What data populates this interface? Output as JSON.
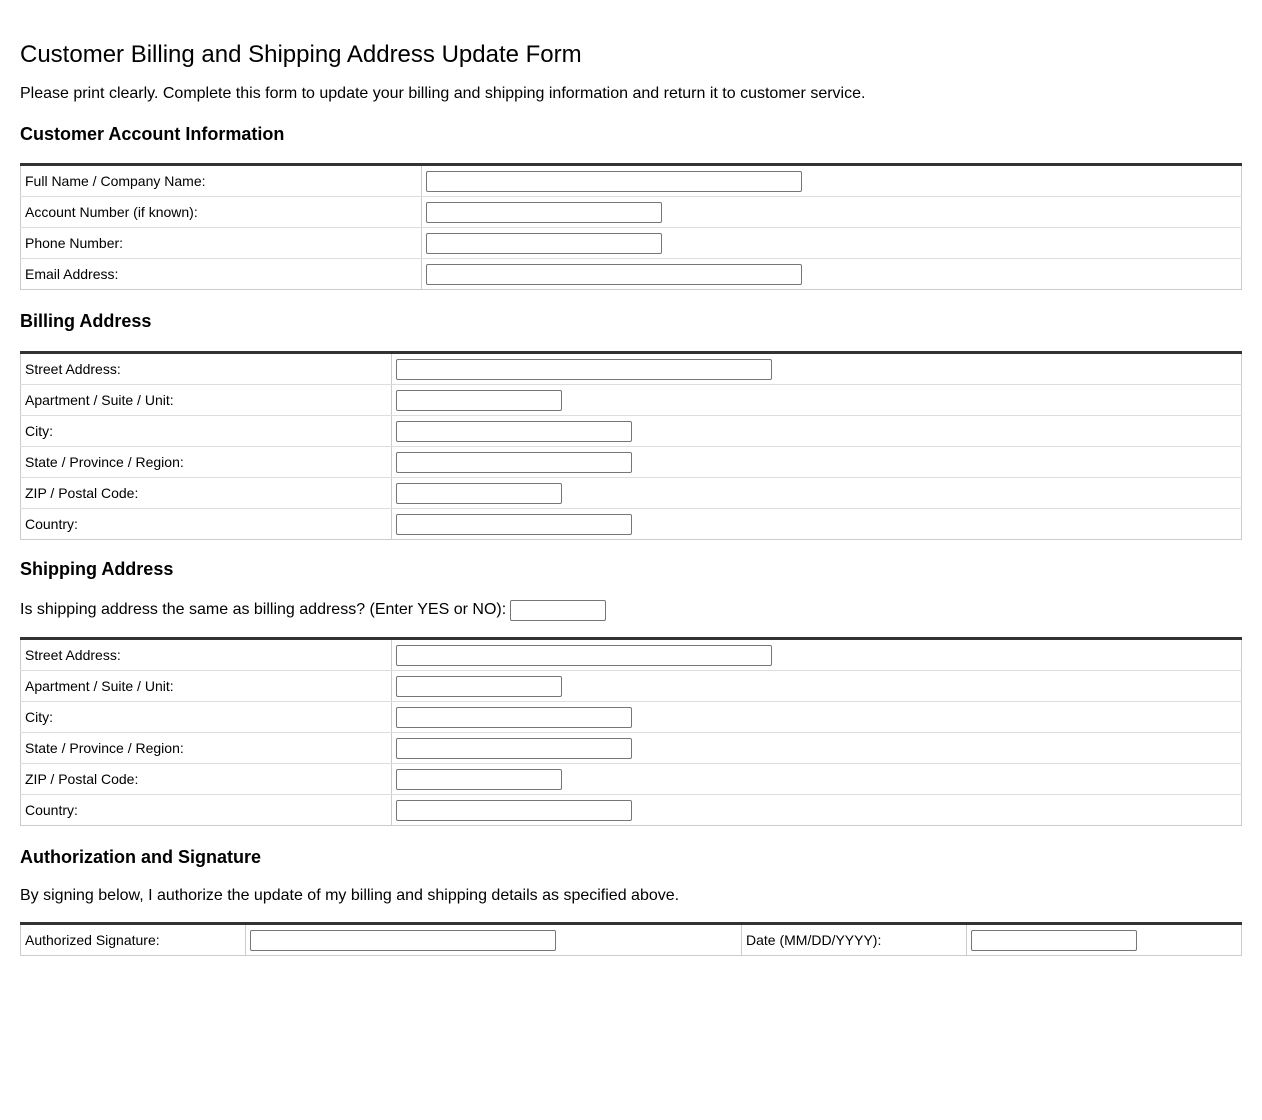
{
  "title": "Customer Billing and Shipping Address Update Form",
  "intro": "Please print clearly. Complete this form to update your billing and shipping information and return it to customer service.",
  "account": {
    "heading": "Customer Account Information",
    "fields": [
      {
        "label": "Full Name / Company Name:",
        "value": ""
      },
      {
        "label": "Account Number (if known):",
        "value": ""
      },
      {
        "label": "Phone Number:",
        "value": ""
      },
      {
        "label": "Email Address:",
        "value": ""
      }
    ]
  },
  "billing": {
    "heading": "Billing Address",
    "fields": [
      {
        "label": "Street Address:",
        "value": ""
      },
      {
        "label": "Apartment / Suite / Unit:",
        "value": ""
      },
      {
        "label": "City:",
        "value": ""
      },
      {
        "label": "State / Province / Region:",
        "value": ""
      },
      {
        "label": "ZIP / Postal Code:",
        "value": ""
      },
      {
        "label": "Country:",
        "value": ""
      }
    ]
  },
  "shipping": {
    "heading": "Shipping Address",
    "same_question": "Is shipping address the same as billing address? (Enter YES or NO):",
    "same_value": "",
    "fields": [
      {
        "label": "Street Address:",
        "value": ""
      },
      {
        "label": "Apartment / Suite / Unit:",
        "value": ""
      },
      {
        "label": "City:",
        "value": ""
      },
      {
        "label": "State / Province / Region:",
        "value": ""
      },
      {
        "label": "ZIP / Postal Code:",
        "value": ""
      },
      {
        "label": "Country:",
        "value": ""
      }
    ]
  },
  "authorization": {
    "heading": "Authorization and Signature",
    "statement": "By signing below, I authorize the update of my billing and shipping details as specified above.",
    "signature_label": "Authorized Signature:",
    "signature_value": "",
    "date_label": "Date (MM/DD/YYYY):",
    "date_value": ""
  }
}
